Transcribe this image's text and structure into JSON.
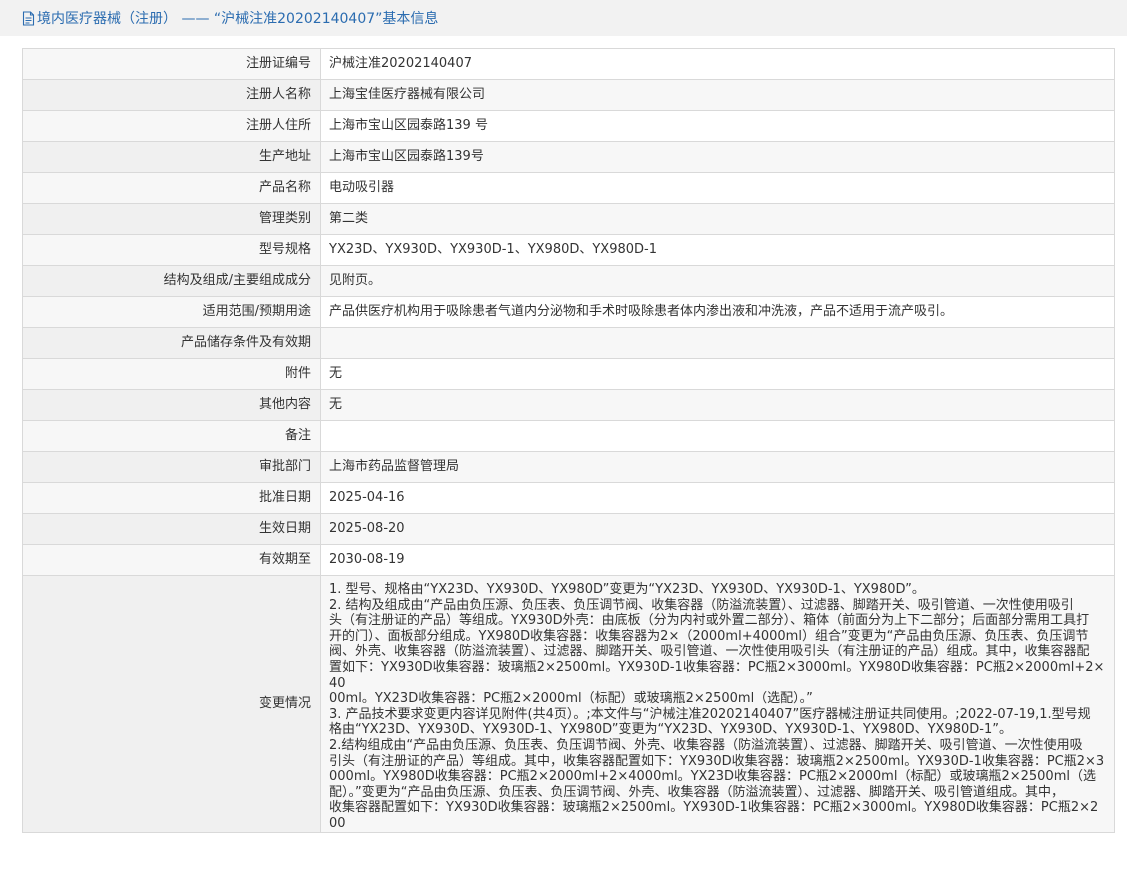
{
  "header": {
    "title": "境内医疗器械（注册） —— “沪械注准20202140407”基本信息",
    "icon": "document-icon"
  },
  "rows": [
    {
      "label": "注册证编号",
      "value": "沪械注准20202140407"
    },
    {
      "label": "注册人名称",
      "value": "上海宝佳医疗器械有限公司"
    },
    {
      "label": "注册人住所",
      "value": "上海市宝山区园泰路139 号"
    },
    {
      "label": "生产地址",
      "value": "上海市宝山区园泰路139号"
    },
    {
      "label": "产品名称",
      "value": "电动吸引器"
    },
    {
      "label": "管理类别",
      "value": "第二类"
    },
    {
      "label": "型号规格",
      "value": "YX23D、YX930D、YX930D-1、YX980D、YX980D-1"
    },
    {
      "label": "结构及组成/主要组成成分",
      "value": "见附页。"
    },
    {
      "label": "适用范围/预期用途",
      "value": "产品供医疗机构用于吸除患者气道内分泌物和手术时吸除患者体内渗出液和冲洗液，产品不适用于流产吸引。"
    },
    {
      "label": "产品储存条件及有效期",
      "value": ""
    },
    {
      "label": "附件",
      "value": "无"
    },
    {
      "label": "其他内容",
      "value": "无"
    },
    {
      "label": "备注",
      "value": ""
    },
    {
      "label": "审批部门",
      "value": "上海市药品监督管理局"
    },
    {
      "label": "批准日期",
      "value": "2025-04-16"
    },
    {
      "label": "生效日期",
      "value": "2025-08-20"
    },
    {
      "label": "有效期至",
      "value": "2030-08-19"
    }
  ],
  "changes": {
    "label": "变更情况",
    "lines": [
      "1. 型号、规格由“YX23D、YX930D、YX980D”变更为“YX23D、YX930D、YX930D-1、YX980D”。",
      "2. 结构及组成由“产品由负压源、负压表、负压调节阀、收集容器（防溢流装置）、过滤器、脚踏开关、吸引管道、一次性使用吸引",
      "头（有注册证的产品）等组成。YX930D外壳：由底板（分为内衬或外置二部分）、箱体（前面分为上下二部分；后面部分需用工具打",
      "开的门）、面板部分组成。YX980D收集容器：收集容器为2×（2000ml+4000ml）组合”变更为“产品由负压源、负压表、负压调节",
      "阀、外壳、收集容器（防溢流装置）、过滤器、脚踏开关、吸引管道、一次性使用吸引头（有注册证的产品）组成。其中，收集容器配",
      "置如下：YX930D收集容器：玻璃瓶2×2500ml。YX930D-1收集容器：PC瓶2×3000ml。YX980D收集容器：PC瓶2×2000ml+2×40",
      "00ml。YX23D收集容器：PC瓶2×2000ml（标配）或玻璃瓶2×2500ml（选配）。”",
      "3. 产品技术要求变更内容详见附件(共4页）。;本文件与“沪械注准20202140407”医疗器械注册证共同使用。;2022-07-19,1.型号规",
      "格由“YX23D、YX930D、YX930D-1、YX980D”变更为“YX23D、YX930D、YX930D-1、YX980D、YX980D-1”。",
      "2.结构组成由“产品由负压源、负压表、负压调节阀、外壳、收集容器（防溢流装置）、过滤器、脚踏开关、吸引管道、一次性使用吸",
      "引头（有注册证的产品）等组成。其中，收集容器配置如下：YX930D收集容器：玻璃瓶2×2500ml。YX930D-1收集容器：PC瓶2×3",
      "000ml。YX980D收集容器：PC瓶2×2000ml+2×4000ml。YX23D收集容器：PC瓶2×2000ml（标配）或玻璃瓶2×2500ml（选",
      "配）。”变更为“产品由负压源、负压表、负压调节阀、外壳、收集容器（防溢流装置）、过滤器、脚踏开关、吸引管道组成。其中，",
      "收集容器配置如下：YX930D收集容器：玻璃瓶2×2500ml。YX930D-1收集容器：PC瓶2×3000ml。YX980D收集容器：PC瓶2×200"
    ]
  }
}
